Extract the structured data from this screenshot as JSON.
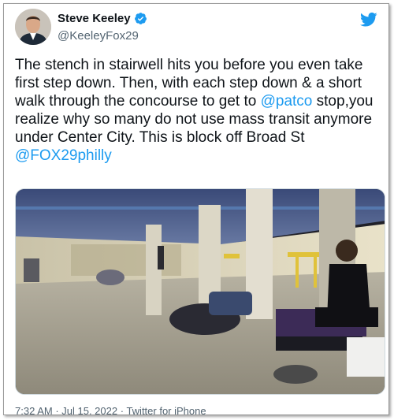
{
  "tweet": {
    "display_name": "Steve Keeley",
    "handle": "@KeeleyFox29",
    "verified_icon": "verified-badge-icon",
    "brand_icon": "twitter-bird-icon",
    "text_part1": "The stench in stairwell hits you before you even take first step down.  Then, with each step down & a short walk through the concourse to get to ",
    "mention1": "@patco",
    "text_part2": " stop,you realize why so many do not use mass transit anymore under Center City. This is block off Broad St ",
    "mention2": "@FOX29philly",
    "time": "7:32 AM",
    "sep1": " · ",
    "date": "Jul 15, 2022",
    "sep2": " · ",
    "source": "Twitter for iPhone"
  },
  "colors": {
    "link": "#1d9bf0",
    "secondary_text": "#536471",
    "primary_text": "#0f1419"
  }
}
